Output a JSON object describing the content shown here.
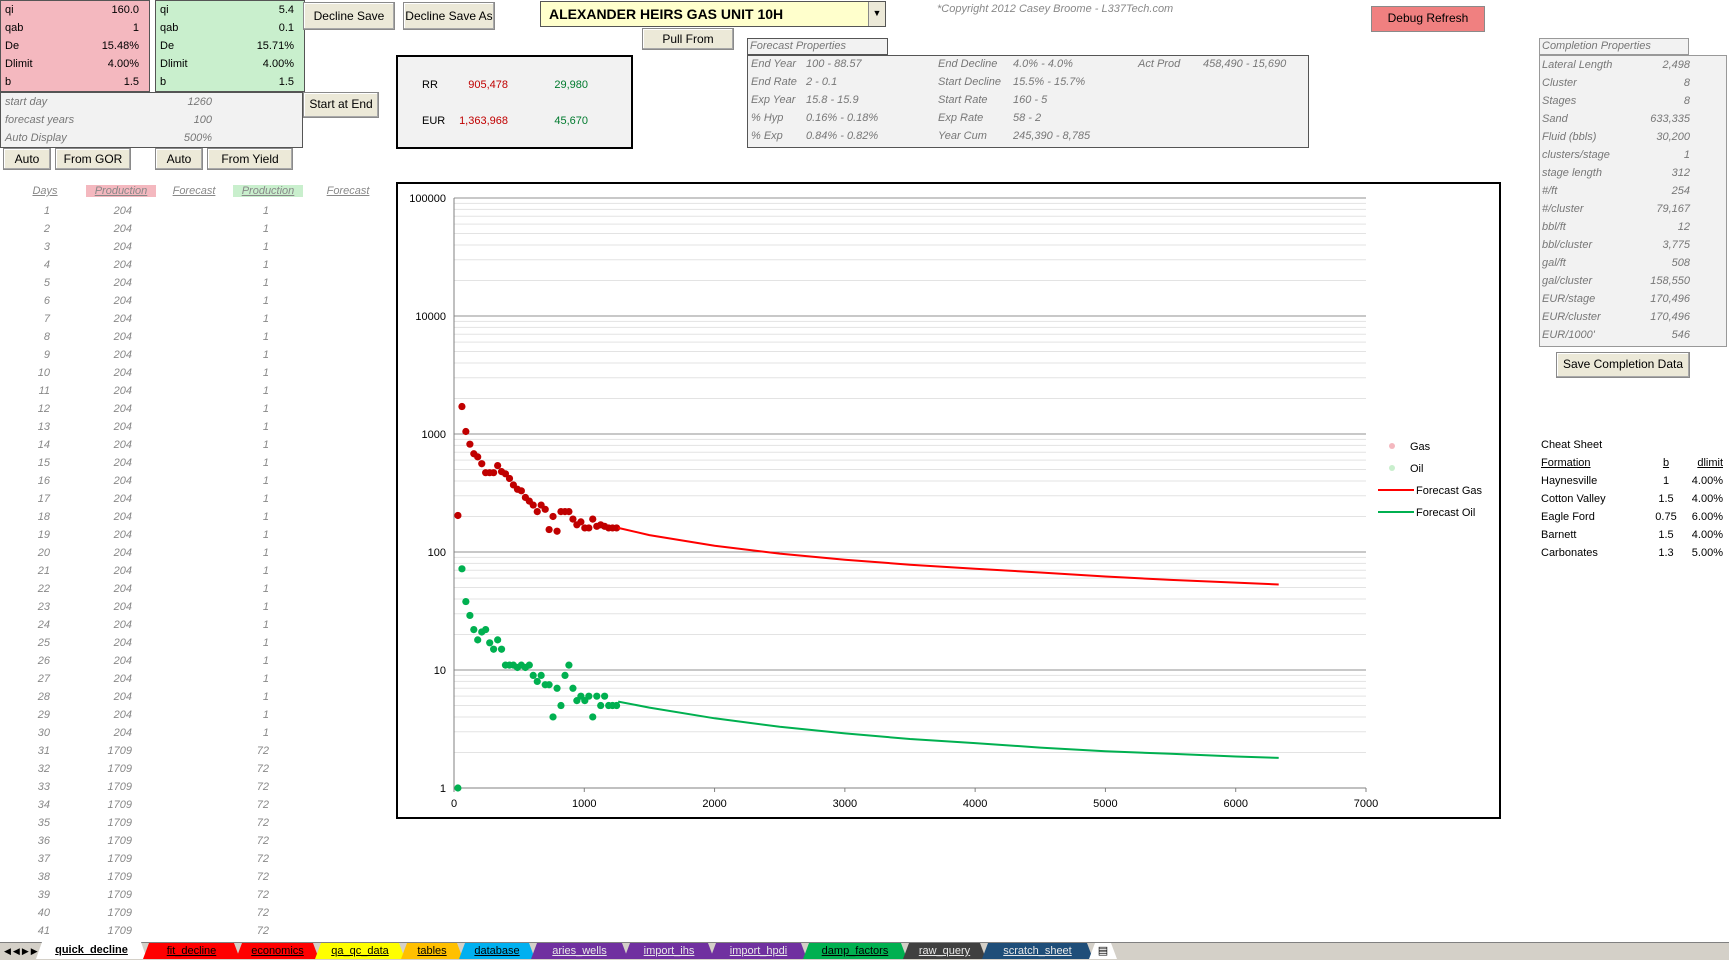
{
  "params_gas": [
    {
      "key": "qi",
      "value": "160.0"
    },
    {
      "key": "qab",
      "value": "1"
    },
    {
      "key": "De",
      "value": "15.48%"
    },
    {
      "key": "Dlimit",
      "value": "4.00%"
    },
    {
      "key": "b",
      "value": "1.5"
    }
  ],
  "params_oil": [
    {
      "key": "qi",
      "value": "5.4"
    },
    {
      "key": "qab",
      "value": "0.1"
    },
    {
      "key": "De",
      "value": "15.71%"
    },
    {
      "key": "Dlimit",
      "value": "4.00%"
    },
    {
      "key": "b",
      "value": "1.5"
    }
  ],
  "settings": [
    {
      "key": "start day",
      "value": "1260"
    },
    {
      "key": "forecast years",
      "value": "100"
    },
    {
      "key": "Auto Display",
      "value": "500%"
    }
  ],
  "buttons": {
    "decline_save": "Decline Save",
    "decline_save_as": "Decline Save As",
    "pull_from": "Pull From",
    "debug_refresh": "Debug Refresh",
    "start_at_end": "Start at End",
    "auto_gas": "Auto",
    "from_gor": "From GOR",
    "auto_oil": "Auto",
    "from_yield": "From Yield",
    "save_completion": "Save Completion Data"
  },
  "well_select": {
    "value": "ALEXANDER HEIRS GAS UNIT 10H"
  },
  "copyright": "*Copyright 2012 Casey Broome - L337Tech.com",
  "reserves": {
    "rr_label": "RR",
    "rr_gas": "905,478",
    "rr_oil": "29,980",
    "eur_label": "EUR",
    "eur_gas": "1,363,968",
    "eur_oil": "45,670"
  },
  "forecast_properties": {
    "title": "Forecast Properties",
    "col1": [
      {
        "k": "End Year",
        "v": "100 - 88.57"
      },
      {
        "k": "End Rate",
        "v": "2 - 0.1"
      },
      {
        "k": "Exp Year",
        "v": "15.8 - 15.9"
      },
      {
        "k": "% Hyp",
        "v": "0.16% - 0.18%"
      },
      {
        "k": "% Exp",
        "v": "0.84% - 0.82%"
      }
    ],
    "col2": [
      {
        "k": "End Decline",
        "v": "4.0% - 4.0%"
      },
      {
        "k": "Start Decline",
        "v": "15.5% - 15.7%"
      },
      {
        "k": "Start Rate",
        "v": "160 - 5"
      },
      {
        "k": "Exp Rate",
        "v": "58 - 2"
      },
      {
        "k": "Year Cum",
        "v": "245,390 - 8,785"
      }
    ],
    "col3": [
      {
        "k": "Act Prod",
        "v": "458,490 - 15,690"
      }
    ]
  },
  "completion_properties": {
    "title": "Completion Properties",
    "rows": [
      {
        "k": "Lateral Length",
        "v": "2,498"
      },
      {
        "k": "Cluster",
        "v": "8"
      },
      {
        "k": "Stages",
        "v": "8"
      },
      {
        "k": "Sand",
        "v": "633,335"
      },
      {
        "k": "Fluid (bbls)",
        "v": "30,200"
      },
      {
        "k": "clusters/stage",
        "v": "1"
      },
      {
        "k": "stage length",
        "v": "312"
      },
      {
        "k": "#/ft",
        "v": "254"
      },
      {
        "k": "#/cluster",
        "v": "79,167"
      },
      {
        "k": "bbl/ft",
        "v": "12"
      },
      {
        "k": "bbl/cluster",
        "v": "3,775"
      },
      {
        "k": "gal/ft",
        "v": "508"
      },
      {
        "k": "gal/cluster",
        "v": "158,550"
      },
      {
        "k": "EUR/stage",
        "v": "170,496"
      },
      {
        "k": "EUR/cluster",
        "v": "170,496"
      },
      {
        "k": "EUR/1000'",
        "v": "546"
      }
    ]
  },
  "cheat_sheet": {
    "title": "Cheat Sheet",
    "headers": {
      "formation": "Formation",
      "b": "b",
      "dlimit": "dlimit"
    },
    "rows": [
      {
        "formation": "Haynesville",
        "b": "1",
        "dlimit": "4.00%"
      },
      {
        "formation": "Cotton Valley",
        "b": "1.5",
        "dlimit": "4.00%"
      },
      {
        "formation": "Eagle Ford",
        "b": "0.75",
        "dlimit": "6.00%"
      },
      {
        "formation": "Barnett",
        "b": "1.5",
        "dlimit": "4.00%"
      },
      {
        "formation": "Carbonates",
        "b": "1.3",
        "dlimit": "5.00%"
      }
    ]
  },
  "table": {
    "headers": {
      "days": "Days",
      "gas_prod": "Production",
      "gas_fc": "Forecast",
      "oil_prod": "Production",
      "oil_fc": "Forecast"
    },
    "rows": [
      [
        "1",
        "204",
        "1"
      ],
      [
        "2",
        "204",
        "1"
      ],
      [
        "3",
        "204",
        "1"
      ],
      [
        "4",
        "204",
        "1"
      ],
      [
        "5",
        "204",
        "1"
      ],
      [
        "6",
        "204",
        "1"
      ],
      [
        "7",
        "204",
        "1"
      ],
      [
        "8",
        "204",
        "1"
      ],
      [
        "9",
        "204",
        "1"
      ],
      [
        "10",
        "204",
        "1"
      ],
      [
        "11",
        "204",
        "1"
      ],
      [
        "12",
        "204",
        "1"
      ],
      [
        "13",
        "204",
        "1"
      ],
      [
        "14",
        "204",
        "1"
      ],
      [
        "15",
        "204",
        "1"
      ],
      [
        "16",
        "204",
        "1"
      ],
      [
        "17",
        "204",
        "1"
      ],
      [
        "18",
        "204",
        "1"
      ],
      [
        "19",
        "204",
        "1"
      ],
      [
        "20",
        "204",
        "1"
      ],
      [
        "21",
        "204",
        "1"
      ],
      [
        "22",
        "204",
        "1"
      ],
      [
        "23",
        "204",
        "1"
      ],
      [
        "24",
        "204",
        "1"
      ],
      [
        "25",
        "204",
        "1"
      ],
      [
        "26",
        "204",
        "1"
      ],
      [
        "27",
        "204",
        "1"
      ],
      [
        "28",
        "204",
        "1"
      ],
      [
        "29",
        "204",
        "1"
      ],
      [
        "30",
        "204",
        "1"
      ],
      [
        "31",
        "1709",
        "72"
      ],
      [
        "32",
        "1709",
        "72"
      ],
      [
        "33",
        "1709",
        "72"
      ],
      [
        "34",
        "1709",
        "72"
      ],
      [
        "35",
        "1709",
        "72"
      ],
      [
        "36",
        "1709",
        "72"
      ],
      [
        "37",
        "1709",
        "72"
      ],
      [
        "38",
        "1709",
        "72"
      ],
      [
        "39",
        "1709",
        "72"
      ],
      [
        "40",
        "1709",
        "72"
      ],
      [
        "41",
        "1709",
        "72"
      ]
    ]
  },
  "chart_data": {
    "type": "scatter",
    "title": "",
    "xlabel": "",
    "ylabel": "",
    "xlim": [
      0,
      7000
    ],
    "ylim": [
      1,
      100000
    ],
    "y_scale": "log",
    "x_ticks": [
      "0",
      "1000",
      "2000",
      "3000",
      "4000",
      "5000",
      "6000",
      "7000"
    ],
    "y_ticks": [
      "1",
      "10",
      "100",
      "1000",
      "10000",
      "100000"
    ],
    "legend_position": "right",
    "series": [
      {
        "name": "Gas",
        "kind": "points",
        "color": "#c00000",
        "x": [
          30,
          61,
          91,
          122,
          152,
          182,
          213,
          243,
          274,
          304,
          335,
          365,
          395,
          426,
          456,
          487,
          517,
          548,
          578,
          608,
          639,
          669,
          700,
          730,
          760,
          791,
          821,
          852,
          882,
          913,
          943,
          974,
          1004,
          1035,
          1065,
          1096,
          1126,
          1156,
          1187,
          1217,
          1248
        ],
        "y": [
          204,
          1709,
          1050,
          820,
          680,
          640,
          560,
          470,
          470,
          470,
          540,
          480,
          460,
          420,
          370,
          340,
          330,
          290,
          270,
          250,
          220,
          250,
          230,
          155,
          200,
          150,
          220,
          220,
          220,
          190,
          170,
          180,
          160,
          160,
          190,
          165,
          170,
          165,
          160,
          160,
          160
        ]
      },
      {
        "name": "Oil",
        "kind": "points",
        "color": "#00b050",
        "x": [
          30,
          61,
          91,
          122,
          152,
          182,
          213,
          243,
          274,
          304,
          335,
          365,
          395,
          426,
          456,
          487,
          517,
          548,
          578,
          608,
          639,
          669,
          700,
          730,
          760,
          791,
          821,
          852,
          882,
          913,
          943,
          974,
          1004,
          1035,
          1065,
          1096,
          1126,
          1156,
          1187,
          1217,
          1248
        ],
        "y": [
          1,
          72,
          38,
          29,
          22,
          18,
          21,
          22,
          17,
          15,
          18,
          15,
          11,
          11,
          11,
          10.5,
          11,
          10.5,
          11,
          9,
          8,
          9,
          7.5,
          7.5,
          4,
          7,
          5,
          9,
          11,
          7,
          5.5,
          6,
          5.5,
          6,
          4,
          6,
          5,
          6,
          5,
          5,
          5
        ]
      },
      {
        "name": "Forecast Gas",
        "kind": "line",
        "color": "#ff0000",
        "x": [
          1260,
          1500,
          2000,
          2500,
          3000,
          3500,
          4000,
          4500,
          5000,
          5500,
          6000,
          6330
        ],
        "y": [
          160,
          139,
          113,
          97,
          86,
          78,
          72,
          67,
          62,
          58,
          55,
          53
        ]
      },
      {
        "name": "Forecast Oil",
        "kind": "line",
        "color": "#00b050",
        "x": [
          1260,
          1500,
          2000,
          2500,
          3000,
          3500,
          4000,
          4500,
          5000,
          5500,
          6000,
          6330
        ],
        "y": [
          5.4,
          4.8,
          3.9,
          3.3,
          2.9,
          2.6,
          2.4,
          2.2,
          2.05,
          1.95,
          1.85,
          1.8
        ]
      }
    ]
  },
  "tabs": [
    {
      "label": "quick_decline",
      "color": "#ffffff",
      "active": true
    },
    {
      "label": "fit_decline",
      "color": "#ff0000"
    },
    {
      "label": "economics",
      "color": "#ff0000"
    },
    {
      "label": "qa_qc_data",
      "color": "#ffff00"
    },
    {
      "label": "tables",
      "color": "#ffc000"
    },
    {
      "label": "database",
      "color": "#00b0f0"
    },
    {
      "label": "aries_wells",
      "color": "#7030a0"
    },
    {
      "label": "import_ihs",
      "color": "#7030a0"
    },
    {
      "label": "import_hpdi",
      "color": "#7030a0"
    },
    {
      "label": "damp_factors",
      "color": "#00b050"
    },
    {
      "label": "raw_query",
      "color": "#404040"
    },
    {
      "label": "scratch_sheet",
      "color": "#1f4e79"
    }
  ]
}
